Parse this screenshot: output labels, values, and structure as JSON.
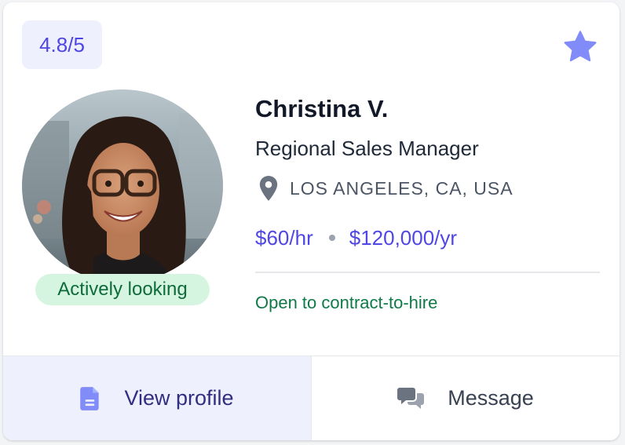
{
  "rating": {
    "text": "4.8/5"
  },
  "profile": {
    "name": "Christina V.",
    "title": "Regional Sales Manager",
    "location": "LOS ANGELES, CA, USA",
    "hourly_rate": "$60/hr",
    "annual_rate": "$120,000/yr",
    "status": "Actively looking",
    "note": "Open to contract-to-hire"
  },
  "actions": {
    "view_profile": "View profile",
    "message": "Message"
  },
  "icons": {
    "favorite": "star-icon",
    "location": "map-pin-icon",
    "view_profile": "document-icon",
    "message": "chat-bubbles-icon"
  },
  "colors": {
    "accent": "#4f46e5",
    "star": "#818cf8",
    "rating_bg": "#eef0fd",
    "status_bg": "#d6f5e0",
    "status_text": "#0e6b3a",
    "note_text": "#0f7a47"
  }
}
